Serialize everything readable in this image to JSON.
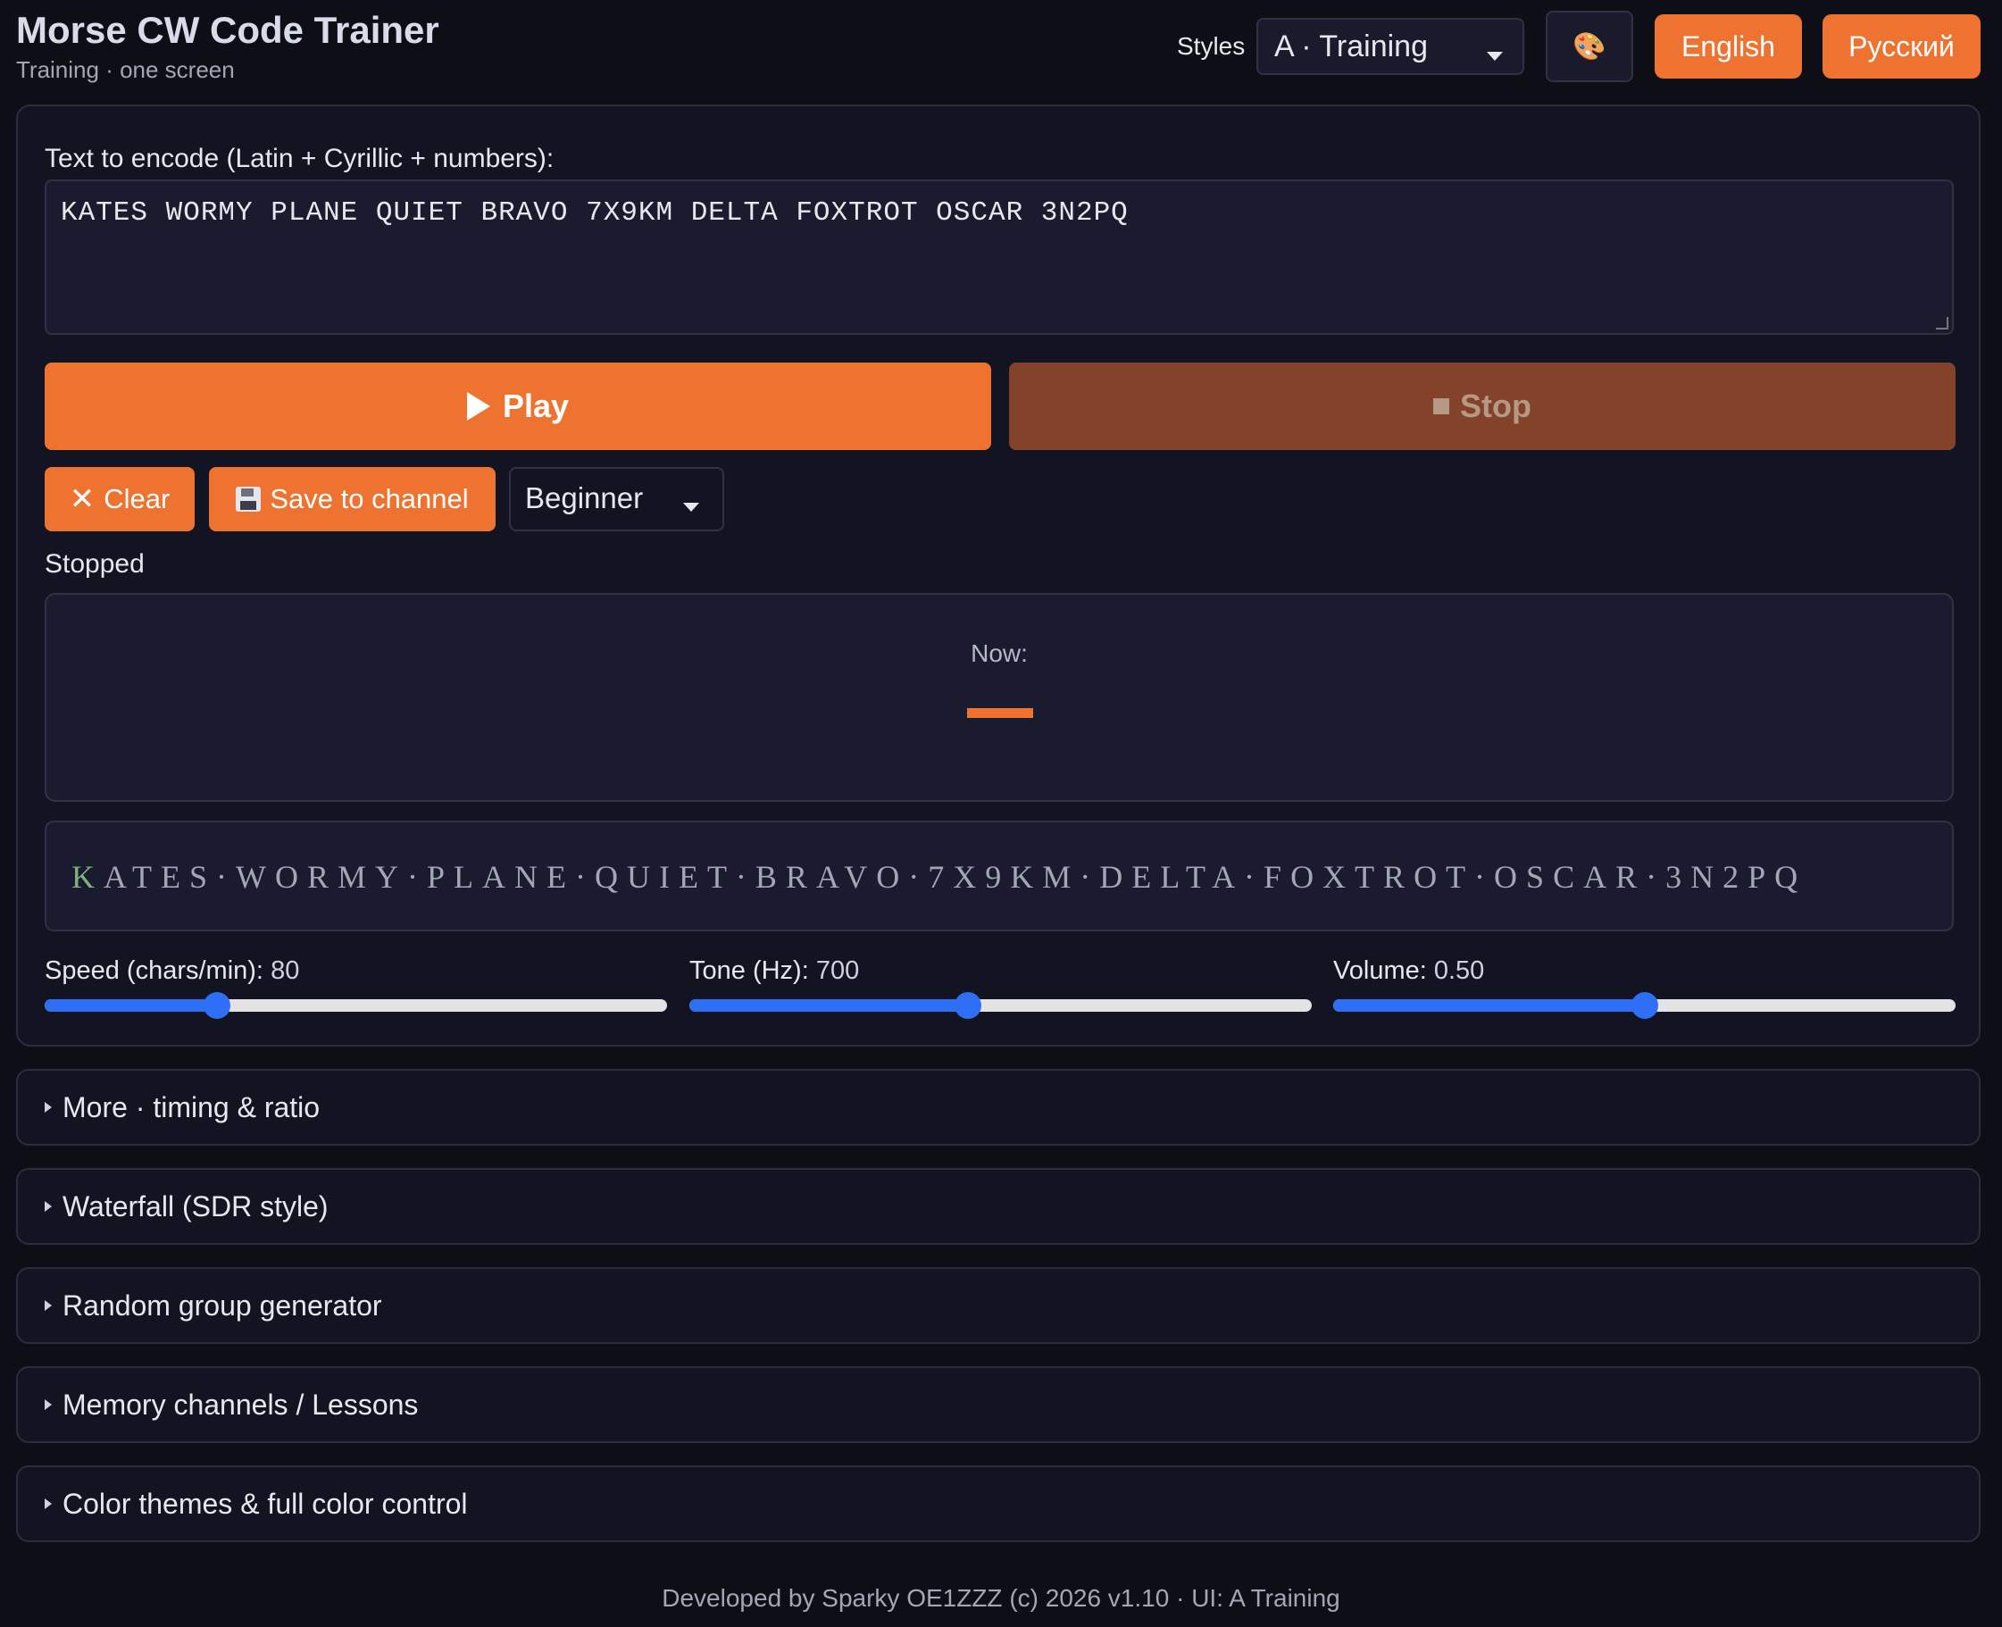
{
  "header": {
    "title": "Morse CW Code Trainer",
    "subtitle": "Training · one screen",
    "styles_label": "Styles",
    "style_selected": "A · Training",
    "palette_icon": "palette-icon",
    "lang_english": "English",
    "lang_russian": "Русский"
  },
  "editor": {
    "label": "Text to encode (Latin + Cyrillic + numbers):",
    "text": "KATES WORMY PLANE QUIET BRAVO 7X9KM DELTA FOXTROT OSCAR 3N2PQ"
  },
  "controls": {
    "play": "Play",
    "stop": "Stop",
    "clear": "Clear",
    "save": "Save to channel",
    "level": "Beginner",
    "status": "Stopped"
  },
  "now_panel": {
    "label": "Now:"
  },
  "progress": {
    "done": "K",
    "remaining": "ATES·WORMY·PLANE·QUIET·BRAVO·7X9KM·DELTA·FOXTROT·OSCAR·3N2PQ"
  },
  "sliders": {
    "speed": {
      "label": "Speed (chars/min):",
      "value": "80",
      "fraction": 0.277
    },
    "tone": {
      "label": "Tone (Hz):",
      "value": "700",
      "fraction": 0.447
    },
    "volume": {
      "label": "Volume:",
      "value": "0.50",
      "fraction": 0.5
    }
  },
  "sections": [
    {
      "label": "More · timing & ratio"
    },
    {
      "label": "Waterfall (SDR style)"
    },
    {
      "label": "Random group generator"
    },
    {
      "label": "Memory channels / Lessons"
    },
    {
      "label": "Color themes & full color control"
    }
  ],
  "footer": "Developed by Sparky OE1ZZZ (c) 2026 v1.10 · UI: A Training",
  "colors": {
    "accent": "#ee7330",
    "accent_disabled": "#83432a",
    "slider": "#2f6ff5",
    "background": "#0e0f16",
    "card": "#131422"
  }
}
